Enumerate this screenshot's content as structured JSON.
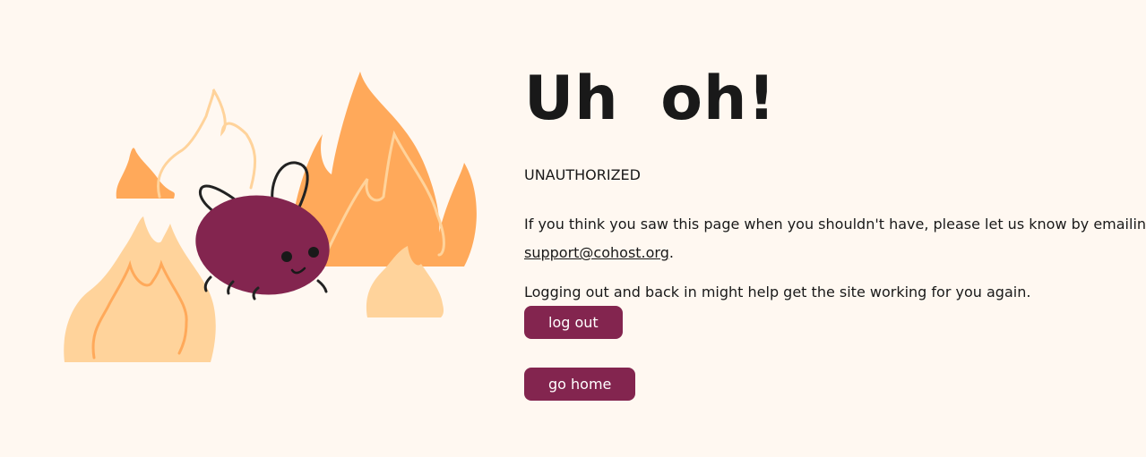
{
  "heading": "Uh oh!",
  "status": "UNAUTHORIZED",
  "message": {
    "before_link": "If you think you saw this page when you shouldn't have, please let us know by emailing",
    "email": "support@cohost.org",
    "after_link": "."
  },
  "logout_hint": "Logging out and back in might help get the site working for you again.",
  "buttons": {
    "logout": "log out",
    "home": "go home"
  },
  "colors": {
    "background": "#fff8f1",
    "accent": "#83254f",
    "fire_dark": "#ffa95a",
    "fire_light": "#ffd39b",
    "bug": "#83254f"
  }
}
